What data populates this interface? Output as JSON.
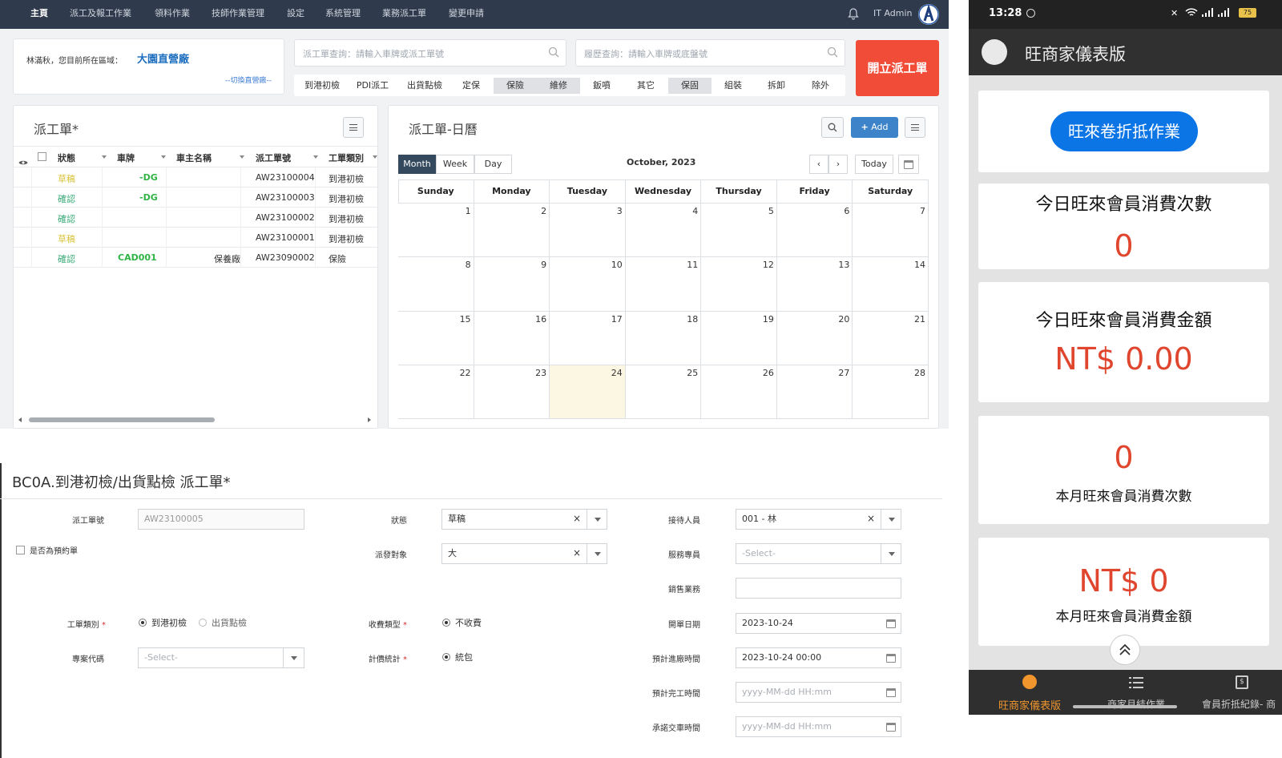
{
  "topnav": {
    "items": [
      "主頁",
      "派工及報工作業",
      "領料作業",
      "技師作業管理",
      "設定",
      "系統管理",
      "業務派工單",
      "變更申請"
    ],
    "user": "IT Admin"
  },
  "location": {
    "greeting": "林滿秋，您目前所在區域：",
    "area": "大園直營廠",
    "switch_link": "--切換直營廠--"
  },
  "search": {
    "order_placeholder": "派工單查詢：請輸入車牌或派工單號",
    "history_placeholder": "履歷查詢：請輸入車牌或底盤號"
  },
  "categories": [
    "到港初檢",
    "PDI派工",
    "出貨點檢",
    "定保",
    "保險",
    "維修",
    "鈑噴",
    "其它",
    "保固",
    "組裝",
    "拆卸",
    "除外"
  ],
  "new_order_button": "開立派工單",
  "order_panel": {
    "title": "派工單*",
    "columns": [
      "狀態",
      "車牌",
      "車主名稱",
      "派工單號",
      "工單類別"
    ],
    "rows": [
      {
        "status": "草稿",
        "plate": "-DG",
        "owner": "",
        "number": "AW23100004",
        "type": "到港初檢"
      },
      {
        "status": "確認",
        "plate": "-DG",
        "owner": "",
        "number": "AW23100003",
        "type": "到港初檢"
      },
      {
        "status": "確認",
        "plate": "",
        "owner": "",
        "number": "AW23100002",
        "type": "到港初檢"
      },
      {
        "status": "草稿",
        "plate": "",
        "owner": "",
        "number": "AW23100001",
        "type": "到港初檢"
      },
      {
        "status": "確認",
        "plate": "CAD001",
        "owner": "保養廠",
        "number": "AW23090002",
        "type": "保險"
      }
    ]
  },
  "calendar": {
    "title": "派工單-日曆",
    "add_label": "Add",
    "views": [
      "Month",
      "Week",
      "Day"
    ],
    "month_label": "October, 2023",
    "today_label": "Today",
    "weekdays": [
      "Sunday",
      "Monday",
      "Tuesday",
      "Wednesday",
      "Thursday",
      "Friday",
      "Saturday"
    ],
    "weeks": [
      [
        1,
        2,
        3,
        4,
        5,
        6,
        7
      ],
      [
        8,
        9,
        10,
        11,
        12,
        13,
        14
      ],
      [
        15,
        16,
        17,
        18,
        19,
        20,
        21
      ],
      [
        22,
        23,
        24,
        25,
        26,
        27,
        28
      ]
    ],
    "highlight_day": 24
  },
  "form": {
    "title": "BC0A.到港初檢/出貨點檢 派工單*",
    "order_no_label": "派工單號",
    "order_no_value": "AW23100005",
    "reservation_label": "是否為預約單",
    "type_label": "工單類別",
    "type_options": [
      "到港初檢",
      "出貨點檢"
    ],
    "project_label": "專案代碼",
    "project_value": "-Select-",
    "status_label": "狀態",
    "status_value": "草稿",
    "dispatch_label": "派發對象",
    "dispatch_value": "大",
    "charge_label": "收費類型",
    "charge_value": "不收費",
    "pricing_label": "計價統計",
    "pricing_value": "統包",
    "receiver_label": "接待人員",
    "receiver_value": "001 - 林",
    "service_label": "服務專員",
    "service_value": "-Select-",
    "sales_label": "銷售業務",
    "open_date_label": "開單日期",
    "open_date_value": "2023-10-24",
    "entry_time_label": "預計進廠時間",
    "entry_time_value": "2023-10-24 00:00",
    "finish_time_label": "預計完工時間",
    "finish_time_placeholder": "yyyy-MM-dd HH:mm",
    "delivery_time_label": "承諾交車時間",
    "delivery_time_placeholder": "yyyy-MM-dd HH:mm"
  },
  "mobile": {
    "time": "13:28",
    "battery": "75",
    "title": "旺商家儀表版",
    "action_button": "旺來卷折抵作業",
    "today_count_label": "今日旺來會員消費次數",
    "today_count_value": "0",
    "today_amount_label": "今日旺來會員消費金額",
    "today_amount_value": "NT$ 0.00",
    "month_count_value": "0",
    "month_count_label": "本月旺來會員消費次數",
    "month_amount_value": "NT$ 0",
    "month_amount_label": "本月旺來會員消費金額",
    "tabs": [
      "旺商家儀表版",
      "商家月結作業",
      "會員折抵紀錄- 商"
    ]
  },
  "colors": {
    "nav_bg": "#2f3a4c",
    "accent_red": "#f04c38",
    "draft": "#d8c33a",
    "confirm": "#3aaa77",
    "plate": "#2fb344",
    "mobile_red": "#e0452e",
    "mobile_blue": "#0c75e6",
    "tab_active": "#f0962d"
  }
}
